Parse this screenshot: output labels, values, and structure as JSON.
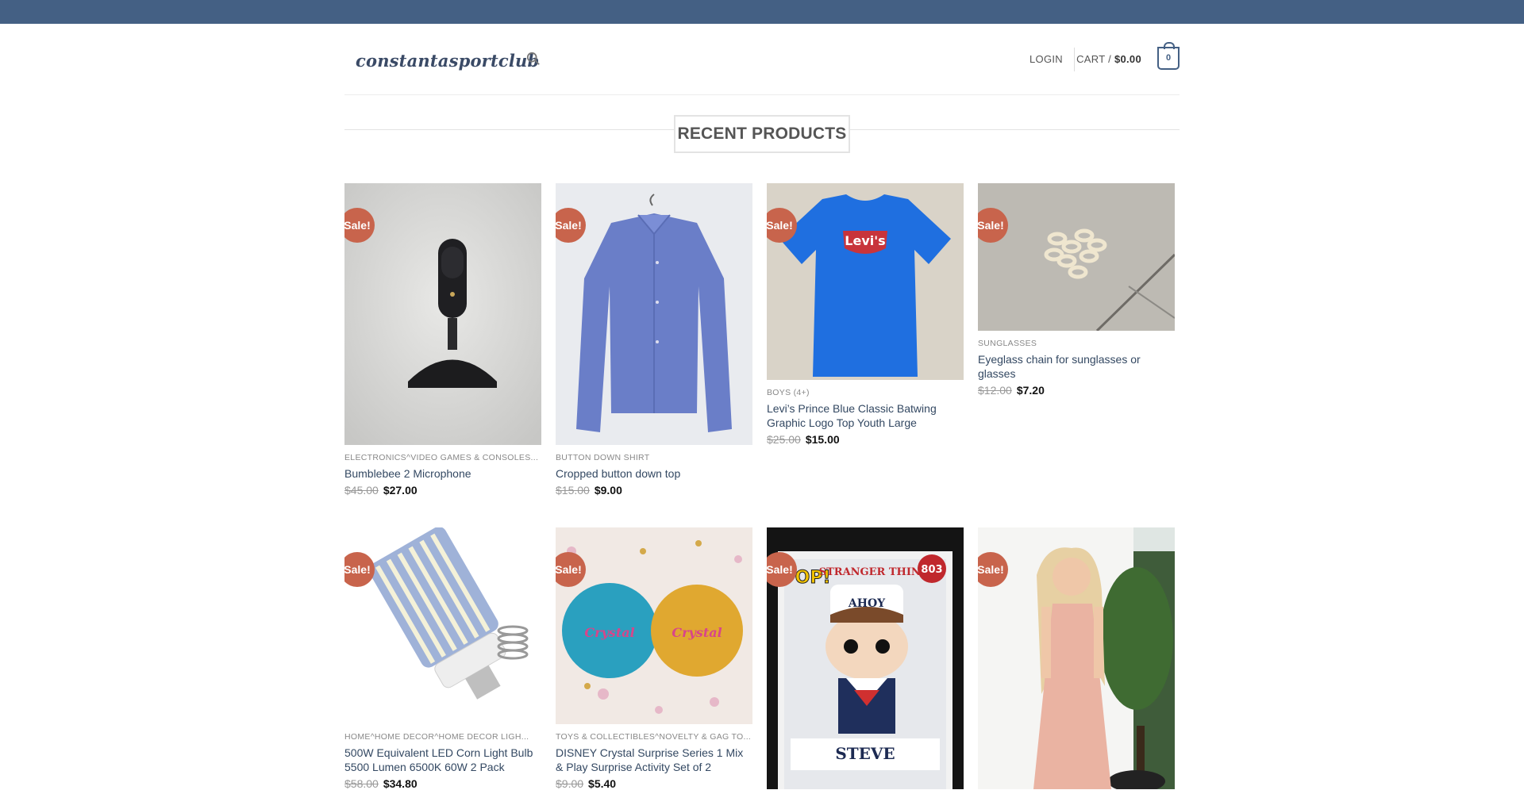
{
  "header": {
    "logo": "constantasportclub",
    "login_label": "LOGIN",
    "cart_label": "CART / ",
    "cart_amount": "$0.00",
    "cart_count": "0"
  },
  "section": {
    "title": "RECENT PRODUCTS"
  },
  "products": [
    {
      "badge": "Sale!",
      "category": "ELECTRONICS^VIDEO GAMES & CONSOLES...",
      "name": "Bumblebee 2 Microphone",
      "old_price": "$45.00",
      "price": "$27.00",
      "image": "black-microphone"
    },
    {
      "badge": "Sale!",
      "category": "BUTTON DOWN SHIRT",
      "name": "Cropped button down top",
      "old_price": "$15.00",
      "price": "$9.00",
      "image": "blue-shirt"
    },
    {
      "badge": "Sale!",
      "category": "BOYS (4+)",
      "name": "Levi’s Prince Blue Classic Batwing Graphic Logo Top Youth Large",
      "old_price": "$25.00",
      "price": "$15.00",
      "image": "blue-tshirt"
    },
    {
      "badge": "Sale!",
      "category": "SUNGLASSES",
      "name": "Eyeglass chain for sunglasses or glasses",
      "old_price": "$12.00",
      "price": "$7.20",
      "image": "eyeglass-chain"
    },
    {
      "badge": "Sale!",
      "category": "HOME^HOME DECOR^HOME DECOR LIGH...",
      "name": "500W Equivalent LED Corn Light Bulb 5500 Lumen 6500K 60W 2 Pack",
      "old_price": "$58.00",
      "price": "$34.80",
      "image": "led-bulb"
    },
    {
      "badge": "Sale!",
      "category": "TOYS & COLLECTIBLES^NOVELTY & GAG TO...",
      "name": "DISNEY Crystal Surprise Series 1 Mix & Play Surprise Activity Set of 2",
      "old_price": "$9.00",
      "price": "$5.40",
      "image": "surprise-balls"
    },
    {
      "badge": "Sale!",
      "category": "",
      "name": "",
      "old_price": "",
      "price": "",
      "image": "funko-pop",
      "box_text": [
        "POP!",
        "STRANGER THINGS",
        "803",
        "AHOY",
        "STEVE"
      ]
    },
    {
      "badge": "Sale!",
      "category": "",
      "name": "",
      "old_price": "",
      "price": "",
      "image": "pink-dress"
    }
  ]
}
